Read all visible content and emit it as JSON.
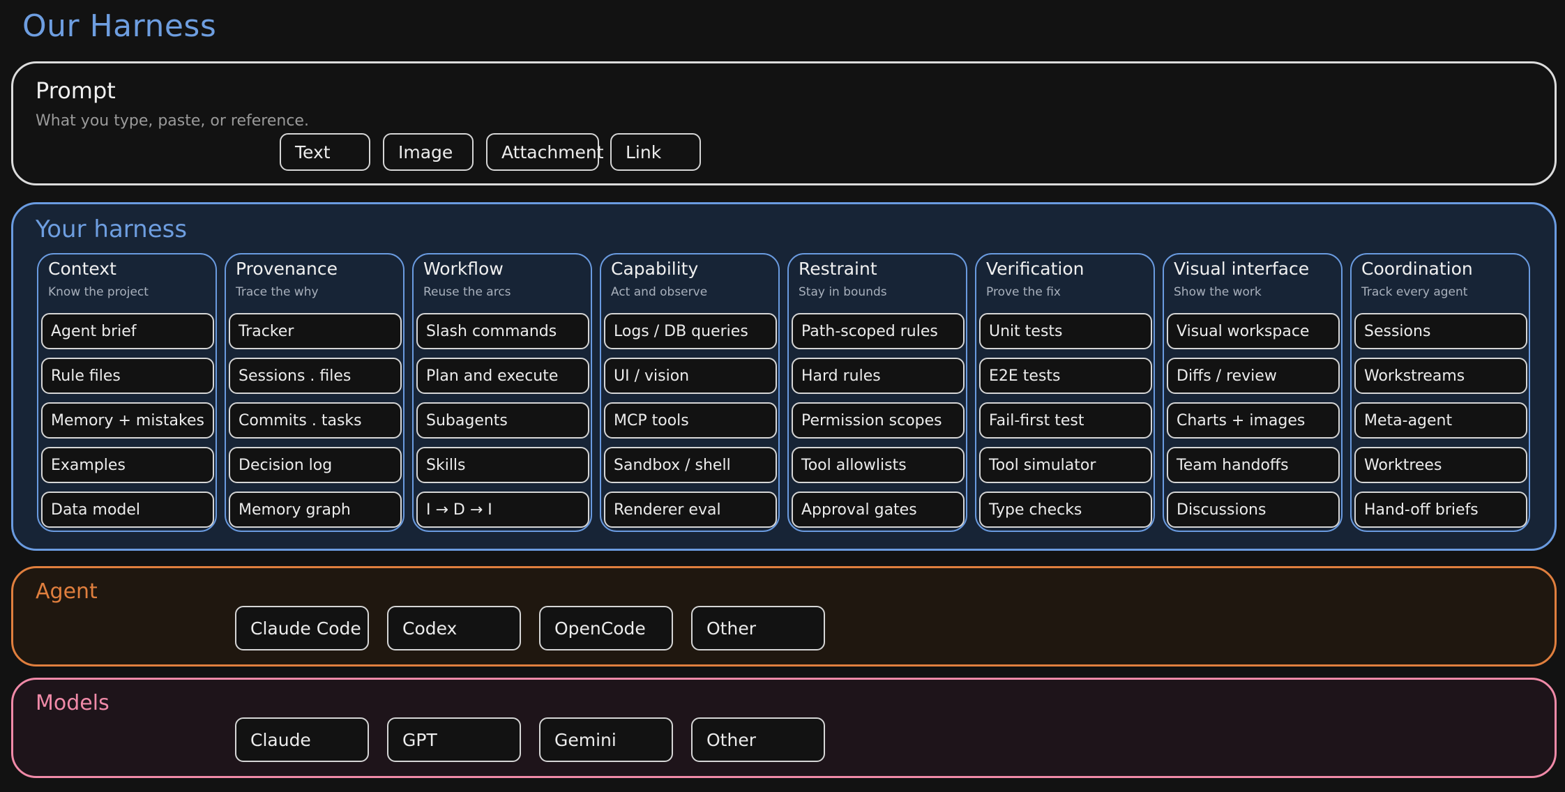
{
  "page": {
    "title": "Our Harness"
  },
  "prompt": {
    "title": "Prompt",
    "subtitle": "What you type, paste, or reference.",
    "items": [
      "Text",
      "Image",
      "Attachment",
      "Link"
    ]
  },
  "harness": {
    "title": "Your harness",
    "columns": [
      {
        "title": "Context",
        "subtitle": "Know the project",
        "items": [
          "Agent brief",
          "Rule files",
          "Memory + mistakes",
          "Examples",
          "Data model"
        ]
      },
      {
        "title": "Provenance",
        "subtitle": "Trace the why",
        "items": [
          "Tracker",
          "Sessions . files",
          "Commits . tasks",
          "Decision log",
          "Memory graph"
        ]
      },
      {
        "title": "Workflow",
        "subtitle": "Reuse the arcs",
        "items": [
          "Slash commands",
          "Plan and execute",
          "Subagents",
          "Skills",
          "I → D → I"
        ]
      },
      {
        "title": "Capability",
        "subtitle": "Act and observe",
        "items": [
          "Logs / DB queries",
          "UI / vision",
          "MCP tools",
          "Sandbox / shell",
          "Renderer eval"
        ]
      },
      {
        "title": "Restraint",
        "subtitle": "Stay in bounds",
        "items": [
          "Path-scoped rules",
          "Hard rules",
          "Permission scopes",
          "Tool allowlists",
          "Approval gates"
        ]
      },
      {
        "title": "Verification",
        "subtitle": "Prove the fix",
        "items": [
          "Unit tests",
          "E2E tests",
          "Fail-first test",
          "Tool simulator",
          "Type checks"
        ]
      },
      {
        "title": "Visual interface",
        "subtitle": "Show the work",
        "items": [
          "Visual workspace",
          "Diffs / review",
          "Charts + images",
          "Team handoffs",
          "Discussions"
        ]
      },
      {
        "title": "Coordination",
        "subtitle": "Track every agent",
        "items": [
          "Sessions",
          "Workstreams",
          "Meta-agent",
          "Worktrees",
          "Hand-off briefs"
        ]
      }
    ]
  },
  "agent": {
    "title": "Agent",
    "items": [
      "Claude Code",
      "Codex",
      "OpenCode",
      "Other"
    ]
  },
  "models": {
    "title": "Models",
    "items": [
      "Claude",
      "GPT",
      "Gemini",
      "Other"
    ]
  },
  "colors": {
    "prompt_border": "#dcdcdc",
    "harness_border": "#6a9be0",
    "agent_border": "#e07f3e",
    "models_border": "#f08aa8",
    "background": "#121212"
  }
}
